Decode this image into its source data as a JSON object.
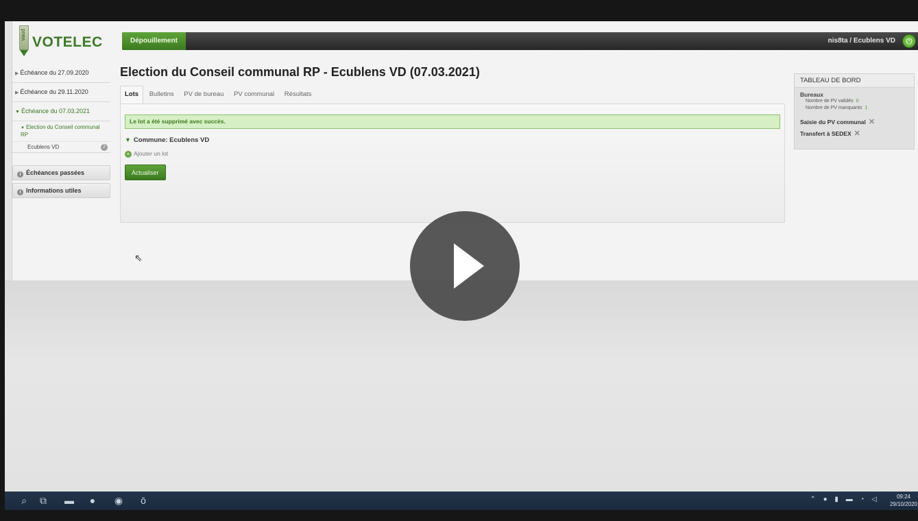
{
  "header": {
    "logo_text": "VOTELEC",
    "logo_strip_text": "vaud",
    "active_tab": "Dépouillement",
    "user": "nis8ta  /  Ecublens VD"
  },
  "sidebar": {
    "items": [
      {
        "label": "Échéance du 27.09.2020",
        "expanded": false
      },
      {
        "label": "Échéance du 29.11.2020",
        "expanded": false
      },
      {
        "label": "Échéance du 07.03.2021",
        "expanded": true
      }
    ],
    "sub_item": "Election du Conseil communal RP",
    "leaf": {
      "label": "Ecublens VD",
      "badge": "2"
    },
    "boxes": [
      "Échéances passées",
      "Informations utiles"
    ]
  },
  "main": {
    "title": "Election du Conseil communal RP - Ecublens VD (07.03.2021)",
    "tabs": [
      "Lots",
      "Bulletins",
      "PV de bureau",
      "PV communal",
      "Résultats"
    ],
    "active_tab": "Lots",
    "flash": "Le lot a été supprimé avec succès.",
    "commune": "Commune: Ecublens VD",
    "add_lot": "Ajouter un lot",
    "refresh_button": "Actualiser"
  },
  "dashboard": {
    "title": "TABLEAU DE BORD",
    "section": "Bureaux",
    "rows": [
      {
        "label": "Nombre de PV validés",
        "value": "0"
      },
      {
        "label": "Nombre de PV manquants",
        "value": "1"
      }
    ],
    "links": [
      "Saisie du PV communal",
      "Transfert à SEDEX"
    ]
  },
  "taskbar": {
    "time": "09:24",
    "date": "29/10/2020"
  },
  "colors": {
    "brand_green": "#3b7a20",
    "flash_bg": "#d6efc5",
    "topbar_dark": "#2b2b2b"
  }
}
